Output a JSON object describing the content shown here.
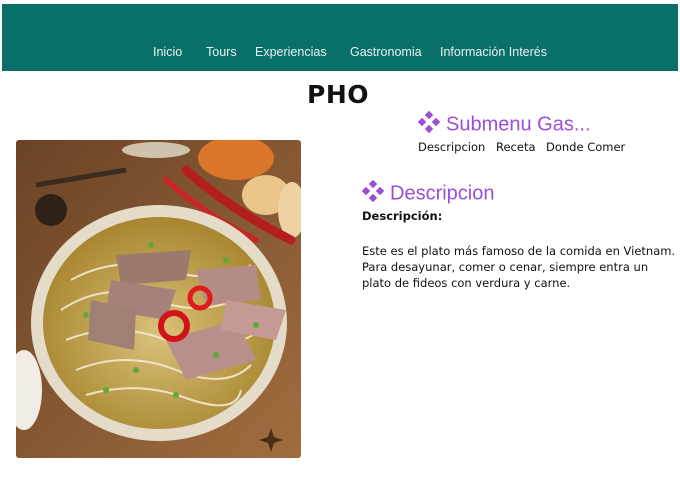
{
  "nav": {
    "items": [
      {
        "label": "Inicio"
      },
      {
        "label": "Tours"
      },
      {
        "label": "Experiencias"
      },
      {
        "label": "Gastronomia"
      },
      {
        "label": "Información Interés"
      }
    ],
    "background": "#096f69"
  },
  "page": {
    "title": "PHO"
  },
  "submenu": {
    "heading": "Submenu Gas...",
    "icon": "diamond-cluster-icon",
    "links": [
      {
        "label": "Descripcion"
      },
      {
        "label": "Receta"
      },
      {
        "label": "Donde Comer"
      }
    ]
  },
  "description": {
    "heading": "Descripcion",
    "icon": "diamond-cluster-icon",
    "label": "Descripción:",
    "text": "Este es el plato más famoso de la comida en Vietnam. Para desayunar, comer o cenar, siempre entra un plato de fideos con verdura y carne."
  },
  "colors": {
    "accent": "#9a4fd8",
    "nav_text": "#e8f3f1"
  }
}
